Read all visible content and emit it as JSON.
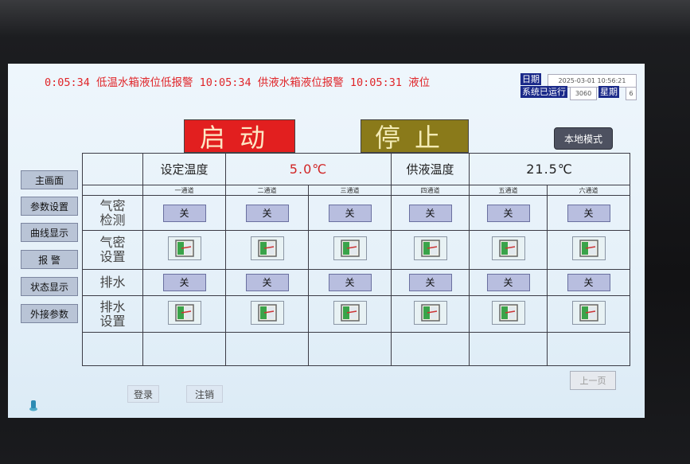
{
  "alarm_bar": {
    "text": "0:05:34 低温水箱液位低报警  10:05:34 供液水箱液位报警  10:05:31 液位"
  },
  "datetime": {
    "date_label": "日期",
    "date_value": "2025-03-01 10:56:21",
    "runtime_label": "系统已运行",
    "runtime_value": "3060",
    "weekday_label": "星期",
    "weekday_value": "6"
  },
  "controls": {
    "start_label": "启动",
    "stop_label": "停止",
    "mode_label": "本地模式"
  },
  "sidebar": {
    "items": [
      {
        "label": "主画面"
      },
      {
        "label": "参数设置"
      },
      {
        "label": "曲线显示"
      },
      {
        "label": "报  警"
      },
      {
        "label": "状态显示"
      },
      {
        "label": "外接参数"
      }
    ]
  },
  "grid": {
    "set_temp_label": "设定温度",
    "set_temp_value": "5.0℃",
    "supply_temp_label": "供液温度",
    "supply_temp_value": "21.5℃",
    "channels": [
      "一通道",
      "二通道",
      "三通道",
      "四通道",
      "五通道",
      "六通道"
    ],
    "rows": {
      "airtight_check": {
        "label_1": "气密",
        "label_2": "检测"
      },
      "airtight_setting": {
        "label_1": "气密",
        "label_2": "设置"
      },
      "drain": {
        "label": "排水"
      },
      "drain_setting": {
        "label_1": "排水",
        "label_2": "设置"
      }
    },
    "off_label": "关",
    "airtight_check_states": [
      "关",
      "关",
      "关",
      "关",
      "关",
      "关"
    ],
    "drain_states": [
      "关",
      "关",
      "关",
      "关",
      "关",
      "关"
    ]
  },
  "footer": {
    "login_label": "登录",
    "logout_label": "注销",
    "prev_label": "上一页"
  },
  "colors": {
    "alarm_text": "#e0262a",
    "start_bg": "#e21f1f",
    "stop_bg": "#8a7a1a",
    "off_button": "#b8bedf"
  }
}
